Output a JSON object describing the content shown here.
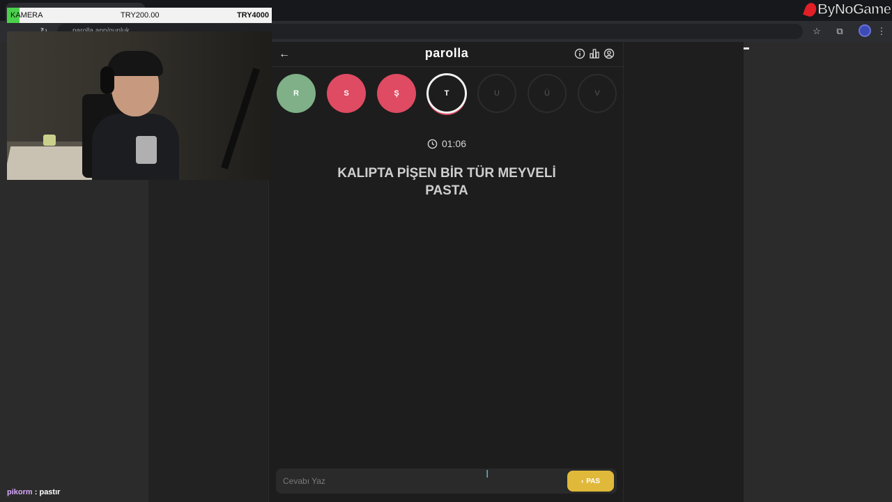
{
  "browser": {
    "url": "parolla.app/gunluk",
    "watermark": "ByNoGame"
  },
  "stream": {
    "kamera_label": "KAMERA",
    "kamera_price": "TRY200.00",
    "kamera_goal": "TRY4000",
    "chat_user": "pikorm",
    "chat_sep": " : ",
    "chat_message": "pastır"
  },
  "app": {
    "title": "parolla",
    "letters": [
      {
        "char": "R",
        "state": "correct"
      },
      {
        "char": "S",
        "state": "wrong"
      },
      {
        "char": "Ş",
        "state": "wrong"
      },
      {
        "char": "T",
        "state": "current"
      },
      {
        "char": "U",
        "state": "pending"
      },
      {
        "char": "Ü",
        "state": "pending"
      },
      {
        "char": "V",
        "state": "pending"
      }
    ],
    "timer": "01:06",
    "question": "KALIPTA PİŞEN BİR TÜR MEYVELİ PASTA",
    "answer_placeholder": "Cevabı Yaz",
    "pass_label": "PAS"
  },
  "colors": {
    "correct": "#7fb087",
    "wrong": "#df4b62",
    "pass": "#e1b93a",
    "kamera_accent": "#4bd14b"
  }
}
